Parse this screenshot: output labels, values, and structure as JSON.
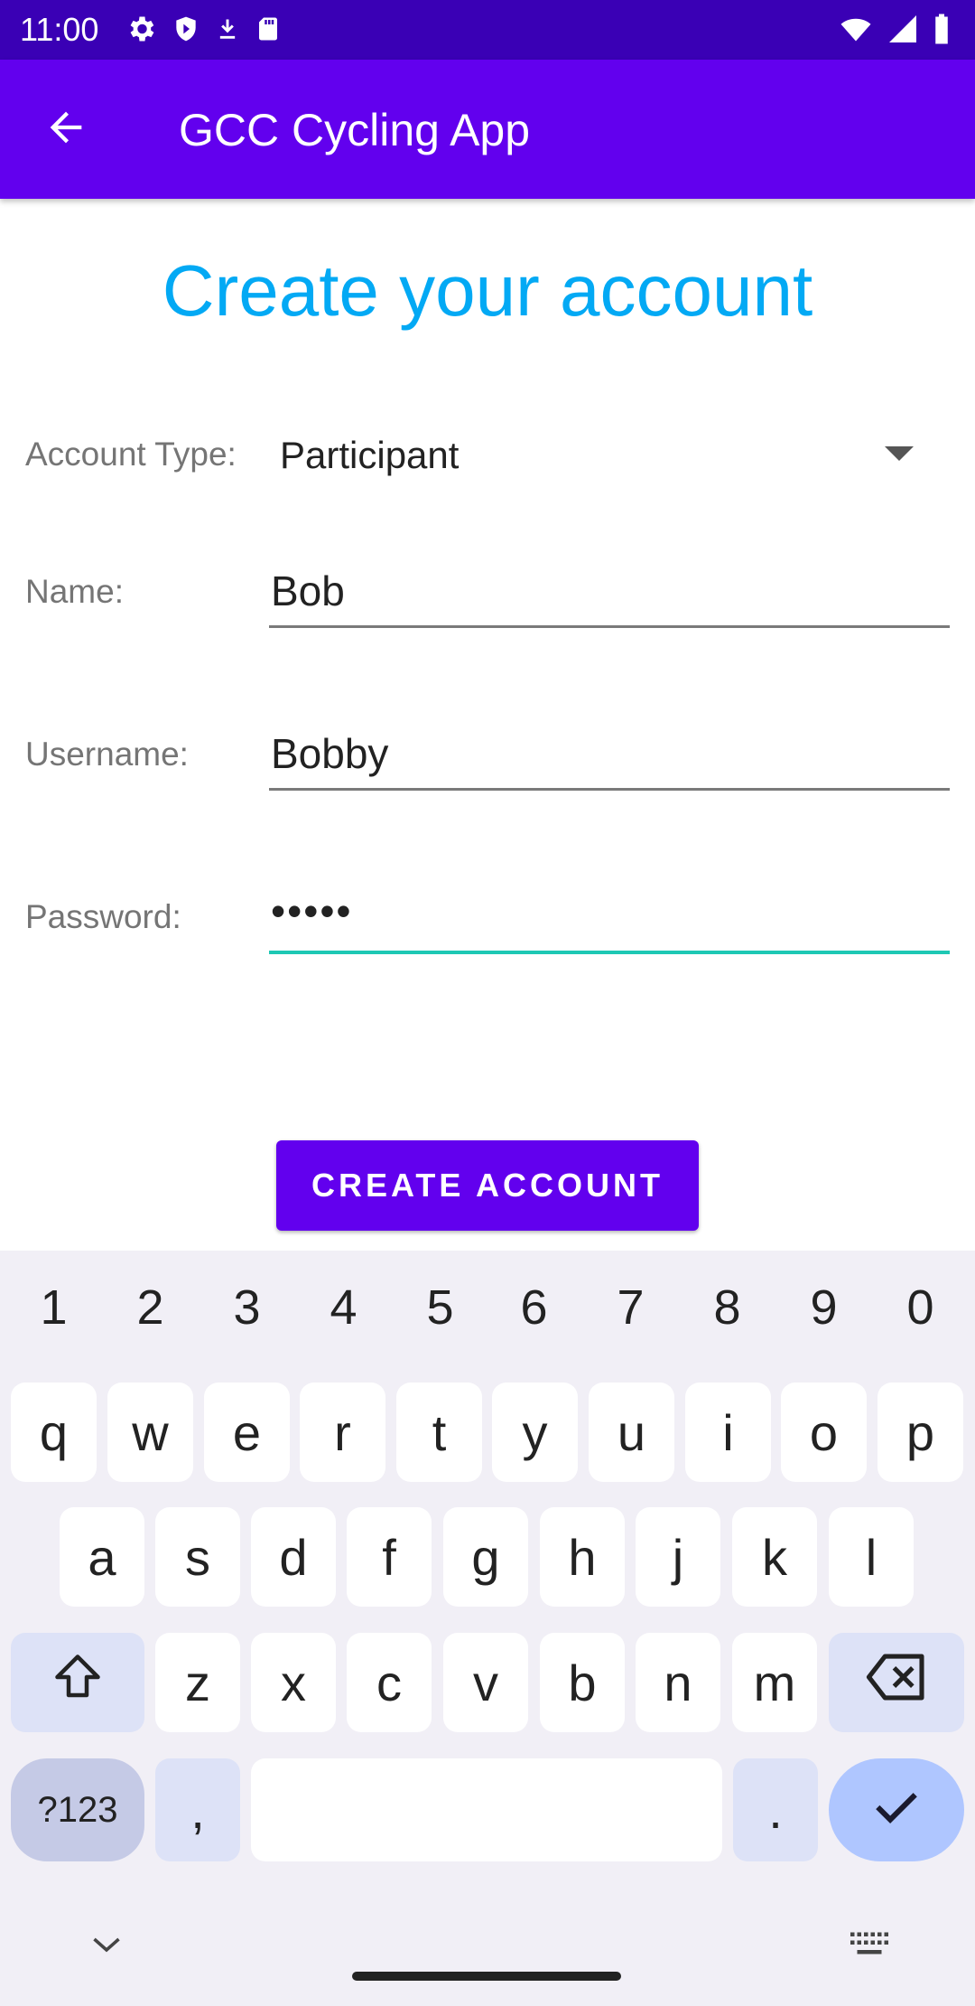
{
  "status_bar": {
    "time": "11:00",
    "left_icons": [
      "gear-icon",
      "play-protect-icon",
      "download-icon",
      "sd-card-icon"
    ],
    "right_icons": [
      "wifi-icon",
      "signal-icon",
      "battery-icon"
    ]
  },
  "app_bar": {
    "title": "GCC Cycling App",
    "back_icon": "arrow-back-icon"
  },
  "form": {
    "title": "Create your account",
    "account_type_label": "Account Type:",
    "account_type_value": "Participant",
    "name_label": "Name:",
    "name_value": "Bob",
    "username_label": "Username:",
    "username_value": "Bobby",
    "password_label": "Password:",
    "password_value": "•••••",
    "submit_label": "CREATE ACCOUNT"
  },
  "keyboard": {
    "numbers": [
      "1",
      "2",
      "3",
      "4",
      "5",
      "6",
      "7",
      "8",
      "9",
      "0"
    ],
    "row1": [
      "q",
      "w",
      "e",
      "r",
      "t",
      "y",
      "u",
      "i",
      "o",
      "p"
    ],
    "row2": [
      "a",
      "s",
      "d",
      "f",
      "g",
      "h",
      "j",
      "k",
      "l"
    ],
    "row3": [
      "z",
      "x",
      "c",
      "v",
      "b",
      "n",
      "m"
    ],
    "symbols_label": "?123",
    "comma": ",",
    "period": "."
  },
  "colors": {
    "status_bar": "#3a00b5",
    "app_bar": "#6200ee",
    "title_accent": "#03a9f4",
    "active_field_underline": "#1ec8b4",
    "button": "#6200ee"
  }
}
